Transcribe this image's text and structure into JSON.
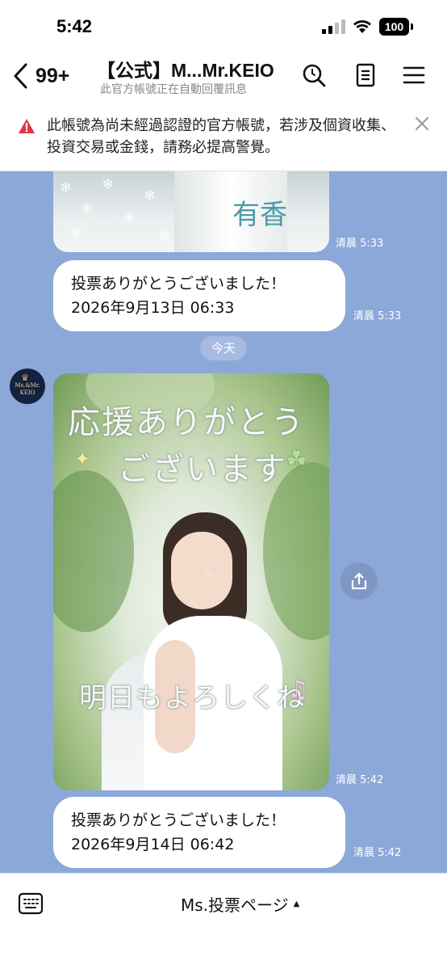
{
  "status_bar": {
    "time": "5:42",
    "battery": "100"
  },
  "header": {
    "back_count": "99+",
    "title": "【公式】M...Mr.KEIO",
    "subtitle": "此官方帳號正在自動回覆訊息",
    "icons": [
      "search-icon",
      "notes-icon",
      "menu-icon"
    ]
  },
  "warning": {
    "text": "此帳號為尚未經過認證的官方帳號，若涉及個資收集、投資交易或金錢，請務必提高警覺。"
  },
  "messages": {
    "photo1": {
      "signature": "有香",
      "time": "清晨 5:33"
    },
    "text1": {
      "line1": "投票ありがとうございました！",
      "line2": "2026年9月13日 06:33",
      "time": "清晨 5:33"
    },
    "date_separator": "今天",
    "avatar": {
      "line1": "Ms.&Mr.",
      "line2": "KEIO"
    },
    "photo2": {
      "line1": "応援ありがとう",
      "line2": "ございます",
      "line3": "明日もよろしくね",
      "time": "清晨 5:42"
    },
    "text2": {
      "line1": "投票ありがとうございました！",
      "line2": "2026年9月14日 06:42",
      "time": "清晨 5:42"
    }
  },
  "bottom_bar": {
    "menu_label": "Ms.投票ページ"
  },
  "colors": {
    "chat_background": "#8ca8d9",
    "warning_red": "#e0353d",
    "bubble": "#ffffff"
  }
}
